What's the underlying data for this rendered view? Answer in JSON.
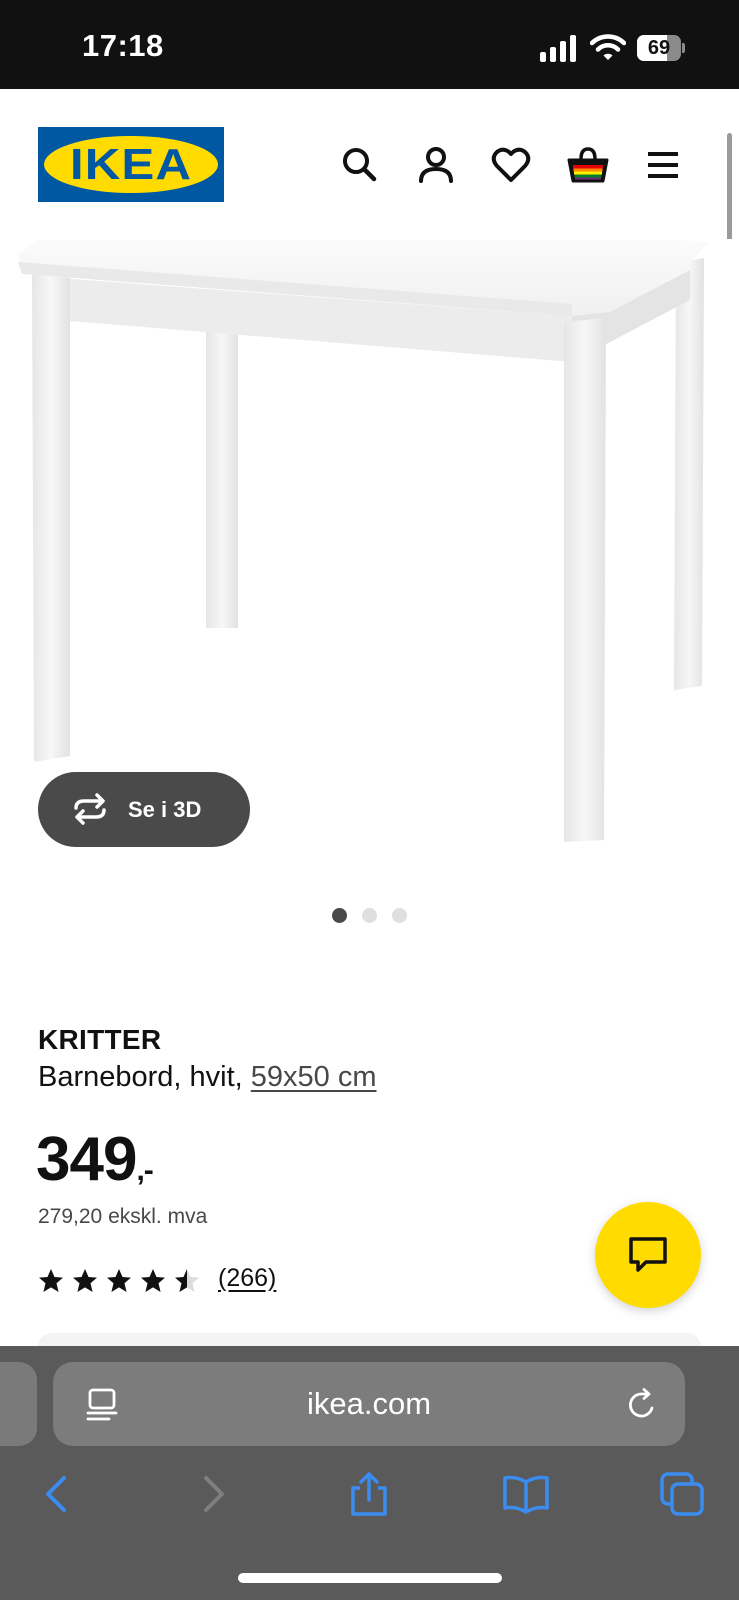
{
  "status_bar": {
    "time": "17:18",
    "battery_level": "69",
    "battery_fraction": 0.69,
    "icons": [
      "signal-icon",
      "wifi-icon",
      "battery-icon"
    ]
  },
  "header": {
    "logo_text": "IKEA",
    "icons": [
      "search-icon",
      "account-icon",
      "heart-icon",
      "shopping-bag-icon",
      "menu-icon"
    ]
  },
  "gallery": {
    "view_3d_label": "Se i 3D",
    "image_count": 3,
    "active_index": 0
  },
  "product": {
    "name": "KRITTER",
    "description": "Barnebord, hvit, ",
    "size": "59x50 cm",
    "price": "349",
    "price_suffix": ",-",
    "price_ex_vat": "279,20 ekskl. mva",
    "rating_stars": 4.5,
    "review_count": "(266)"
  },
  "browser": {
    "url": "ikea.com",
    "icons": [
      "reader-icon",
      "reload-icon",
      "back-icon",
      "forward-icon",
      "share-icon",
      "bookmarks-icon",
      "tabs-icon"
    ]
  },
  "colors": {
    "ikea_blue": "#0058a3",
    "ikea_yellow": "#ffdb00",
    "safari_link": "#3a8cf0"
  }
}
